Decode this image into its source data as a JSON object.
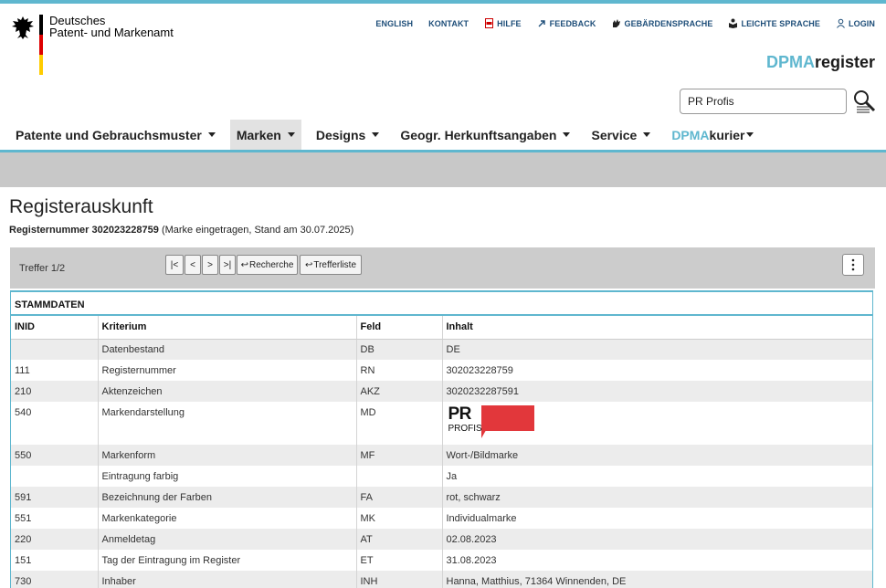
{
  "header": {
    "org_line1": "Deutsches",
    "org_line2": "Patent- und Markenamt",
    "service_links": [
      {
        "label": "ENGLISH",
        "icon": ""
      },
      {
        "label": "KONTAKT",
        "icon": ""
      },
      {
        "label": "HILFE",
        "icon": "pdf-icon"
      },
      {
        "label": "FEEDBACK",
        "icon": "arrow-up-right-icon"
      },
      {
        "label": "GEBÄRDENSPRACHE",
        "icon": "sign-language-icon"
      },
      {
        "label": "LEICHTE SPRACHE",
        "icon": "easy-language-icon"
      },
      {
        "label": "LOGIN",
        "icon": "user-icon"
      }
    ],
    "brand_part1": "DPMA",
    "brand_part2": "register",
    "search_value": "PR Profis"
  },
  "nav": {
    "items": [
      {
        "label": "Patente und Gebrauchsmuster",
        "active": false
      },
      {
        "label": "Marken",
        "active": true
      },
      {
        "label": "Designs",
        "active": false
      },
      {
        "label": "Geogr. Herkunftsangaben",
        "active": false
      },
      {
        "label": "Service",
        "active": false
      }
    ],
    "kurier_part1": "DPMA",
    "kurier_part2": "kurier"
  },
  "page": {
    "title": "Registerauskunft",
    "regnum_label": "Registernummer 302023228759",
    "regnum_status": " (Marke eingetragen, Stand am 30.07.2025)"
  },
  "pager": {
    "treffer": "Treffer 1/2",
    "first": "|<",
    "prev": "<",
    "next": ">",
    "last": ">|",
    "recherche": "Recherche",
    "trefferliste": "Trefferliste"
  },
  "stammdaten": {
    "title": "STAMMDATEN",
    "headers": [
      "INID",
      "Kriterium",
      "Feld",
      "Inhalt"
    ],
    "rows": [
      [
        "",
        "Datenbestand",
        "DB",
        "DE"
      ],
      [
        "111",
        "Registernummer",
        "RN",
        "302023228759"
      ],
      [
        "210",
        "Aktenzeichen",
        "AKZ",
        "3020232287591"
      ],
      [
        "540",
        "Markendarstellung",
        "MD",
        ""
      ],
      [
        "550",
        "Markenform",
        "MF",
        "Wort-/Bildmarke"
      ],
      [
        "",
        "Eintragung farbig",
        "",
        "Ja"
      ],
      [
        "591",
        "Bezeichnung der Farben",
        "FA",
        "rot, schwarz"
      ],
      [
        "551",
        "Markenkategorie",
        "MK",
        "Individualmarke"
      ],
      [
        "220",
        "Anmeldetag",
        "AT",
        "02.08.2023"
      ],
      [
        "151",
        "Tag der Eintragung im Register",
        "ET",
        "31.08.2023"
      ],
      [
        "730",
        "Inhaber",
        "INH",
        "Hanna, Matthius, 71364 Winnenden, DE"
      ]
    ],
    "mark_logo_pr": "PR",
    "mark_logo_profis": "PROFIS"
  },
  "colors": {
    "accent": "#5fb7cf",
    "link": "#1e4e79",
    "logo_red": "#e2373b"
  }
}
